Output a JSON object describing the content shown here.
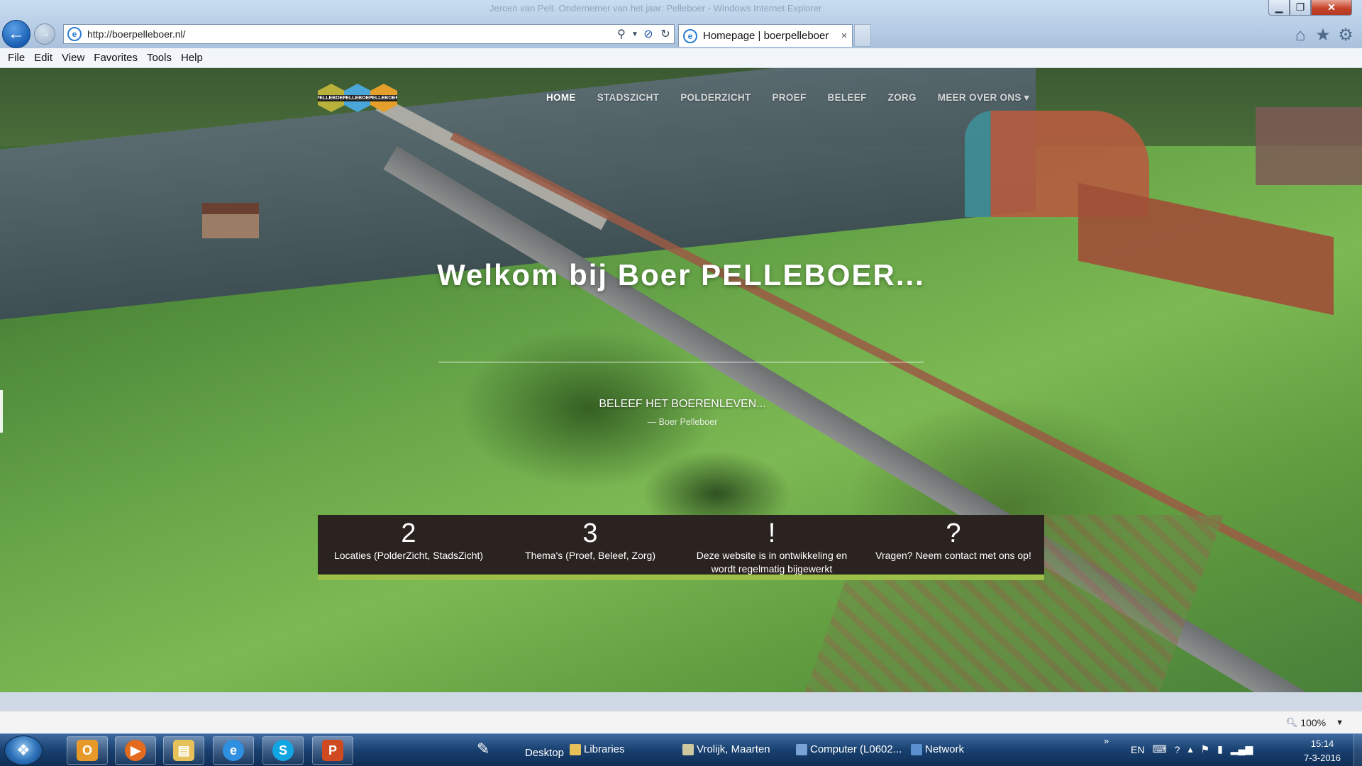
{
  "window": {
    "title_ghost": "Jeroen van Pelt. Ondernemer van het jaar: Pelleboer - Windows Internet Explorer",
    "minimize_icon": "minimize-icon",
    "maximize_icon": "maximize-icon",
    "close_icon": "close-icon"
  },
  "browser": {
    "address_url": "http://boerpelleboer.nl/",
    "tab_title": "Homepage | boerpelleboer",
    "tab_close": "×",
    "menu": [
      "File",
      "Edit",
      "View",
      "Favorites",
      "Tools",
      "Help"
    ],
    "icons": [
      "back-icon",
      "forward-icon",
      "search-icon",
      "stop-icon",
      "refresh-icon",
      "home-icon",
      "star-icon",
      "gear-icon"
    ],
    "zoom": "100%"
  },
  "site": {
    "logo_text": [
      "PELLEBOER",
      "PELLEBOER",
      "PELLEBOER"
    ],
    "nav": [
      "HOME",
      "STADSZICHT",
      "POLDERZICHT",
      "PROEF",
      "BELEEF",
      "ZORG",
      "MEER OVER ONS ▾"
    ],
    "hero": {
      "title_prefix": "Welkom bij Boer ",
      "title_brand": "PELLEBOER",
      "title_suffix": "...",
      "subtitle": "BELEEF HET BOERENLEVEN...",
      "quote": "— Boer Pelleboer"
    },
    "stats": [
      {
        "num": "2",
        "text": "Locaties (PolderZicht, StadsZicht)"
      },
      {
        "num": "3",
        "text": "Thema's (Proef, Beleef, Zorg)"
      },
      {
        "num": "!",
        "text": "Deze website is in ontwikkeling en wordt regelmatig bijgewerkt"
      },
      {
        "num": "?",
        "text": "Vragen? Neem contact met ons op!"
      }
    ],
    "colors": {
      "stats_bg": "#2b2320",
      "accent_green": "#9cbf49"
    }
  },
  "taskbar": {
    "desktop": "Desktop",
    "libraries": "Libraries",
    "user": "Vrolijk, Maarten",
    "computer": "Computer (L0602...",
    "network": "Network",
    "tray_lang": "EN",
    "clock_time": "15:14",
    "clock_date": "7-3-2016",
    "chevron": "»"
  }
}
